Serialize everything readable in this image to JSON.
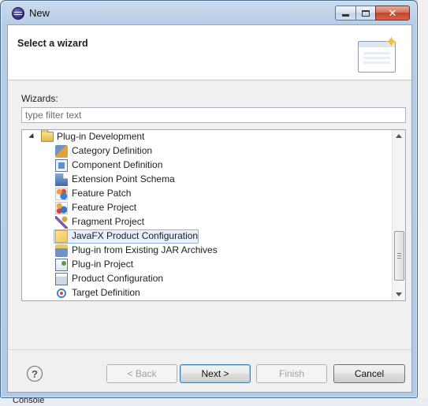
{
  "window": {
    "title": "New",
    "minimize_icon": "minimize-icon",
    "maximize_icon": "maximize-icon",
    "close_icon": "close-icon",
    "close_glyph": "✕"
  },
  "banner": {
    "title": "Select a wizard"
  },
  "filter": {
    "label": "Wizards:",
    "placeholder": "type filter text",
    "value": ""
  },
  "tree": {
    "category": "Plug-in Development",
    "items": [
      {
        "label": "Category Definition",
        "icon": "category-definition-icon"
      },
      {
        "label": "Component Definition",
        "icon": "component-definition-icon"
      },
      {
        "label": "Extension Point Schema",
        "icon": "extension-point-schema-icon"
      },
      {
        "label": "Feature Patch",
        "icon": "feature-patch-icon"
      },
      {
        "label": "Feature Project",
        "icon": "feature-project-icon"
      },
      {
        "label": "Fragment Project",
        "icon": "fragment-project-icon"
      },
      {
        "label": "JavaFX Product Configuration",
        "icon": "javafx-product-configuration-icon",
        "selected": true
      },
      {
        "label": "Plug-in from Existing JAR Archives",
        "icon": "plugin-from-jar-icon"
      },
      {
        "label": "Plug-in Project",
        "icon": "plugin-project-icon"
      },
      {
        "label": "Product Configuration",
        "icon": "product-configuration-icon"
      },
      {
        "label": "Target Definition",
        "icon": "target-definition-icon"
      }
    ]
  },
  "buttons": {
    "help": "?",
    "back": "< Back",
    "next": "Next >",
    "finish": "Finish",
    "cancel": "Cancel"
  },
  "background": {
    "console_tab": "Console"
  },
  "colors": {
    "selection_bg": "#e8f1fb",
    "selection_border": "#8fb5e3",
    "frame_blue": "#b7cde6",
    "close_red": "#c1432a"
  }
}
